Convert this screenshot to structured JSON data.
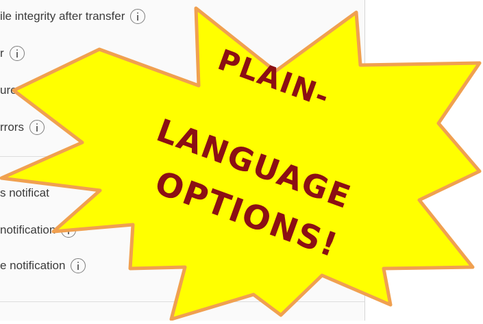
{
  "options": {
    "integrity": "ile integrity after transfer",
    "r": "r",
    "errors_partial": "ure with errors",
    "errors": "rrors"
  },
  "notifications": {
    "first": "s notificat",
    "second": "notification",
    "third": "e notification"
  },
  "burst": {
    "line1": "PLAIN-",
    "line2": "LANGUAGE",
    "line3": "OPTIONS!",
    "fill_color": "#ffff00",
    "stroke_color": "#f0a050",
    "text_color": "#8b0f14"
  }
}
